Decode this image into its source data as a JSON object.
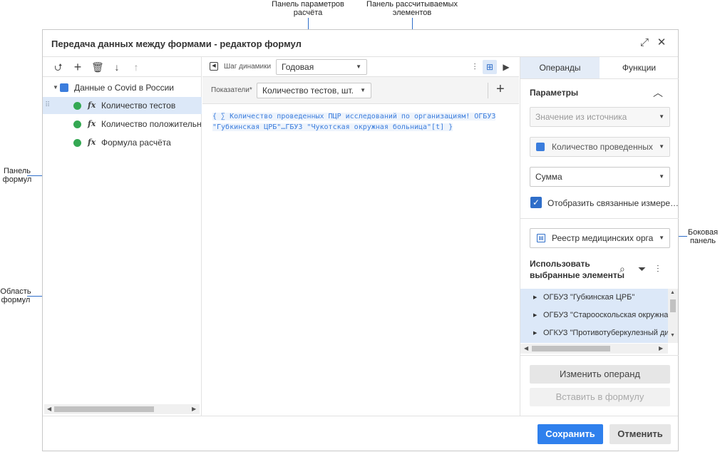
{
  "callouts": {
    "calc_params_panel": "Панель параметров расчёта",
    "calculated_panel": "Панель рассчитываемых элементов",
    "formulas_panel": "Панель формул",
    "formula_area": "Область формул",
    "side_panel": "Боковая панель"
  },
  "dialog": {
    "title": "Передача данных между формами - редактор формул",
    "expand_icon": "expand-icon",
    "close_icon": "close-icon"
  },
  "left_panel": {
    "toolbar_icons": [
      "move-to-icon",
      "add-icon",
      "delete-icon",
      "arrow-down-icon",
      "arrow-up-icon"
    ],
    "tree": {
      "root_label": "Данные о Covid в России",
      "items": [
        {
          "fx": "fx",
          "label": "Количество тестов",
          "selected": true
        },
        {
          "fx": "fx",
          "label": "Количество положительных",
          "selected": false
        },
        {
          "fx": "fx",
          "label": "Формула расчёта",
          "selected": false
        }
      ]
    }
  },
  "middle_panel": {
    "dynamics_label": "Шаг динамики",
    "dynamics_value": "Годовая",
    "indicators_label": "Показатели*",
    "indicators_value": "Количество тестов, шт.",
    "formula_line1": "{ ∑ Количество проведенных ПЦР исследований по организациям! ОГБУЗ",
    "formula_line2": "\"Губкинская ЦРБ\"…ГБУЗ \"Чукотская окружная больница\"[t] }"
  },
  "right_panel": {
    "tabs": [
      "Операнды",
      "Функции"
    ],
    "active_tab": 0,
    "params_title": "Параметры",
    "source_select": "Значение из источника",
    "indicator_select": "Количество проведенных",
    "aggregation_select": "Сумма",
    "show_linked_label": "Отобразить связанные измере…",
    "show_linked_checked": true,
    "registry_select": "Реестр медицинских орга",
    "use_selected_label_1": "Использовать",
    "use_selected_label_2": "выбранные элементы",
    "elements": [
      "ОГБУЗ \"Губкинская ЦРБ\"",
      "ОГБУЗ \"Старооскольская окружная",
      "ОГКУЗ \"Противотуберкулезный ди"
    ],
    "change_operand": "Изменить операнд",
    "insert_formula": "Вставить в формулу"
  },
  "footer": {
    "save": "Сохранить",
    "cancel": "Отменить"
  },
  "colors": {
    "accent": "#2f80ed",
    "selection": "#dce8f8",
    "formula_text": "#3b7ddd",
    "status_green": "#34a853"
  }
}
